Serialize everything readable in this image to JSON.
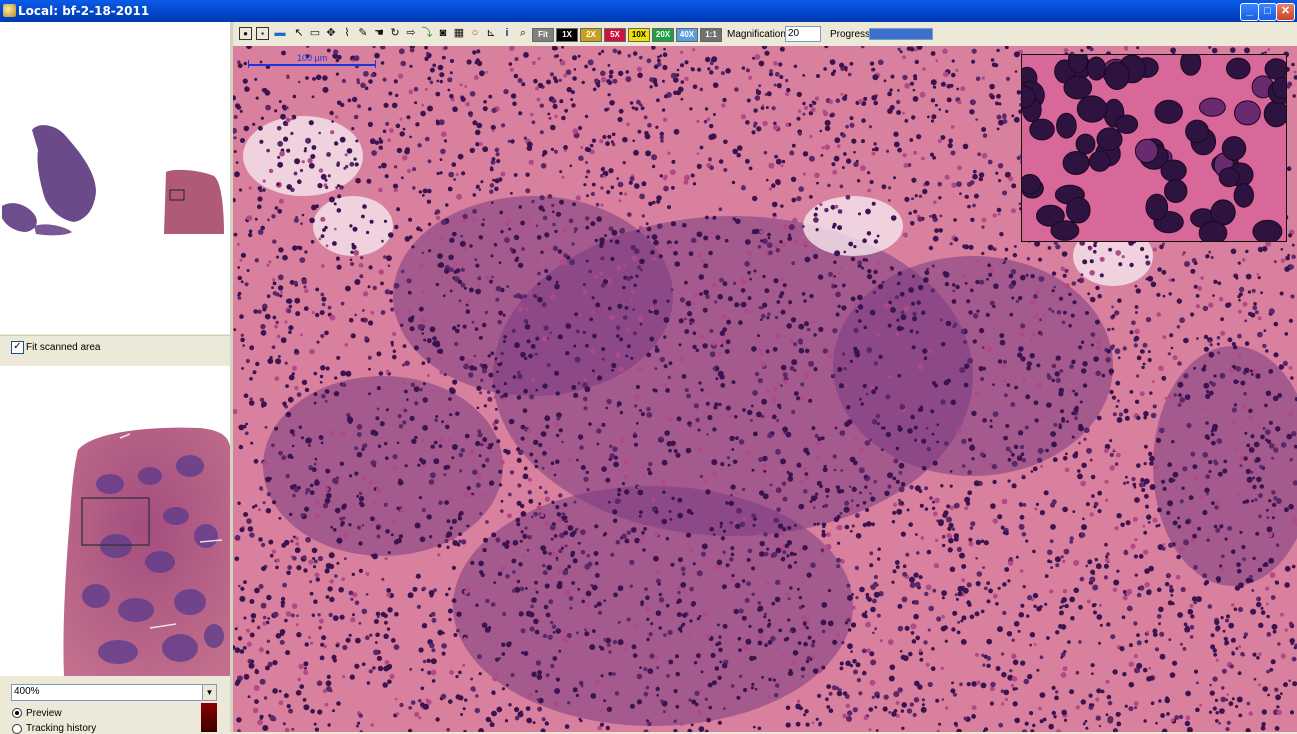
{
  "window": {
    "title": "Local: bf-2-18-2011",
    "minimize": "_",
    "maximize": "□",
    "close": "✕"
  },
  "left_panel": {
    "fit_scanned_area": {
      "checked": true,
      "label": "Fit scanned area"
    },
    "zoom": {
      "selected": "400%"
    },
    "view_modes": [
      {
        "label": "Preview",
        "selected": true
      },
      {
        "label": "Tracking history",
        "selected": false
      }
    ]
  },
  "toolbar": {
    "tool_icons": [
      "slide-icon",
      "page-icon",
      "folder-icon",
      "pointer-icon",
      "window-icon",
      "pan-icon",
      "ruler-icon",
      "annotate-icon",
      "hand-icon",
      "rotate-icon",
      "camera-export-icon",
      "snapshot-icon",
      "filter-icon",
      "circle-icon",
      "chart-icon",
      "info-icon",
      "zoom-icon"
    ],
    "magnification_buttons": [
      {
        "label": "Fit",
        "color": "#808080",
        "text_color": "#ffffff"
      },
      {
        "label": "1X",
        "color": "#000000",
        "text_color": "#ffffff"
      },
      {
        "label": "2X",
        "color": "#c8a020",
        "text_color": "#ffffff"
      },
      {
        "label": "5X",
        "color": "#d01040",
        "text_color": "#ffffff"
      },
      {
        "label": "10X",
        "color": "#f0e000",
        "text_color": "#000000"
      },
      {
        "label": "20X",
        "color": "#20a040",
        "text_color": "#ffffff"
      },
      {
        "label": "40X",
        "color": "#5aa0e0",
        "text_color": "#ffffff"
      },
      {
        "label": "1:1",
        "color": "#707070",
        "text_color": "#ffffff"
      }
    ],
    "magnification_label": "Magnification:",
    "magnification_value": "20",
    "progress_label": "Progress:",
    "progress_fraction": 1.0
  },
  "viewer": {
    "scale_bar_label": "100 µm"
  },
  "colors": {
    "title_bar": "#0054e3",
    "panel": "#ece9d8",
    "tissue_pink": "#d9809e",
    "tissue_purple": "#5a2868"
  }
}
